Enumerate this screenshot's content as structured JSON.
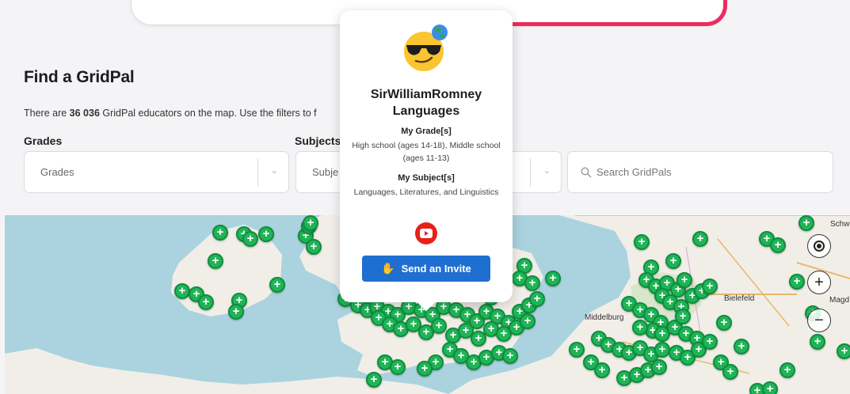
{
  "page": {
    "title": "Find a GridPal",
    "description_pre": "There are ",
    "educator_count": "36 036",
    "description_post": " GridPal educators on the map. Use the filters to f"
  },
  "filters": {
    "grades_label": "Grades",
    "grades_placeholder": "Grades",
    "subjects_label": "Subjects",
    "subjects_placeholder": "Subje",
    "search_placeholder": "Search GridPals"
  },
  "map": {
    "places": [
      "Middelburg",
      "Bielefeld",
      "Schwe",
      "Magd"
    ]
  },
  "popup": {
    "username_line1": "SirWilliamRomney",
    "username_line2": "Languages",
    "grades_heading": "My Grade[s]",
    "grades_value": "High school (ages 14-18), Middle school (ages 11-13)",
    "subjects_heading": "My Subject[s]",
    "subjects_value": "Languages, Literatures, and Linguistics",
    "invite_label": "Send an Invite",
    "avatar_icon": "sunglasses-emoji-icon",
    "badge_icon": "globe-icon",
    "social_icon": "youtube-icon",
    "invite_icon": "waving-hand-icon"
  },
  "colors": {
    "accent_pink": "#ee2a62",
    "button_blue": "#1f6fd1",
    "marker_green": "#20b457",
    "youtube_red": "#e62117"
  }
}
